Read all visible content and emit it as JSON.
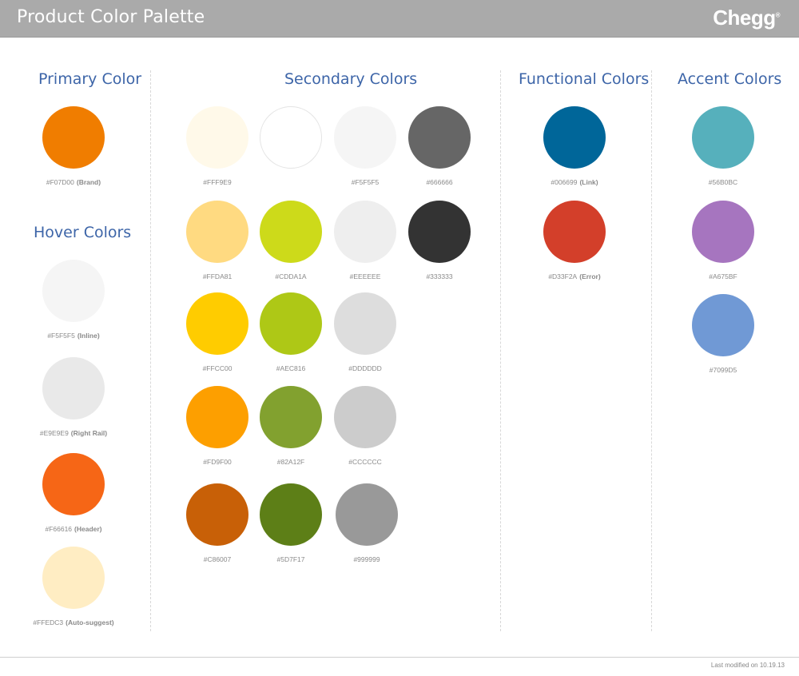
{
  "header": {
    "title": "Product Color Palette",
    "logo": "Chegg",
    "logo_mark": "®"
  },
  "primary": {
    "heading": "Primary Color",
    "swatches": [
      {
        "hex": "#F07D00",
        "label": "(Brand)"
      }
    ]
  },
  "hover": {
    "heading": "Hover Colors",
    "swatches": [
      {
        "hex": "#F5F5F5",
        "label": "(Inline)"
      },
      {
        "hex": "#E9E9E9",
        "label": "(Right Rail)"
      },
      {
        "hex": "#F66616",
        "label": "(Header)"
      },
      {
        "hex": "#FFEDC3",
        "label": "(Auto-suggest)"
      }
    ]
  },
  "secondary": {
    "heading": "Secondary Colors",
    "swatches": [
      {
        "hex": "#FFF9E9",
        "label": ""
      },
      {
        "hex": "#FFFFFF",
        "label": ""
      },
      {
        "hex": "#F5F5F5",
        "label": ""
      },
      {
        "hex": "#666666",
        "label": ""
      },
      {
        "hex": "#FFDA81",
        "label": ""
      },
      {
        "hex": "#CDDA1A",
        "label": ""
      },
      {
        "hex": "#EEEEEE",
        "label": ""
      },
      {
        "hex": "#333333",
        "label": ""
      },
      {
        "hex": "#FFCC00",
        "label": ""
      },
      {
        "hex": "#AEC816",
        "label": ""
      },
      {
        "hex": "#DDDDDD",
        "label": ""
      },
      {
        "hex": "#FD9F00",
        "label": ""
      },
      {
        "hex": "#82A12F",
        "label": ""
      },
      {
        "hex": "#CCCCCC",
        "label": ""
      },
      {
        "hex": "#C86007",
        "label": ""
      },
      {
        "hex": "#5D7F17",
        "label": ""
      },
      {
        "hex": "#999999",
        "label": ""
      }
    ]
  },
  "functional": {
    "heading": "Functional Colors",
    "swatches": [
      {
        "hex": "#006699",
        "label": "(Link)"
      },
      {
        "hex": "#D33F2A",
        "label": "(Error)"
      }
    ]
  },
  "accent": {
    "heading": "Accent Colors",
    "swatches": [
      {
        "hex": "#56B0BC",
        "label": ""
      },
      {
        "hex": "#A675BF",
        "label": ""
      },
      {
        "hex": "#7099D5",
        "label": ""
      }
    ]
  },
  "footer": {
    "last_modified": "Last modified on 10.19.13"
  }
}
